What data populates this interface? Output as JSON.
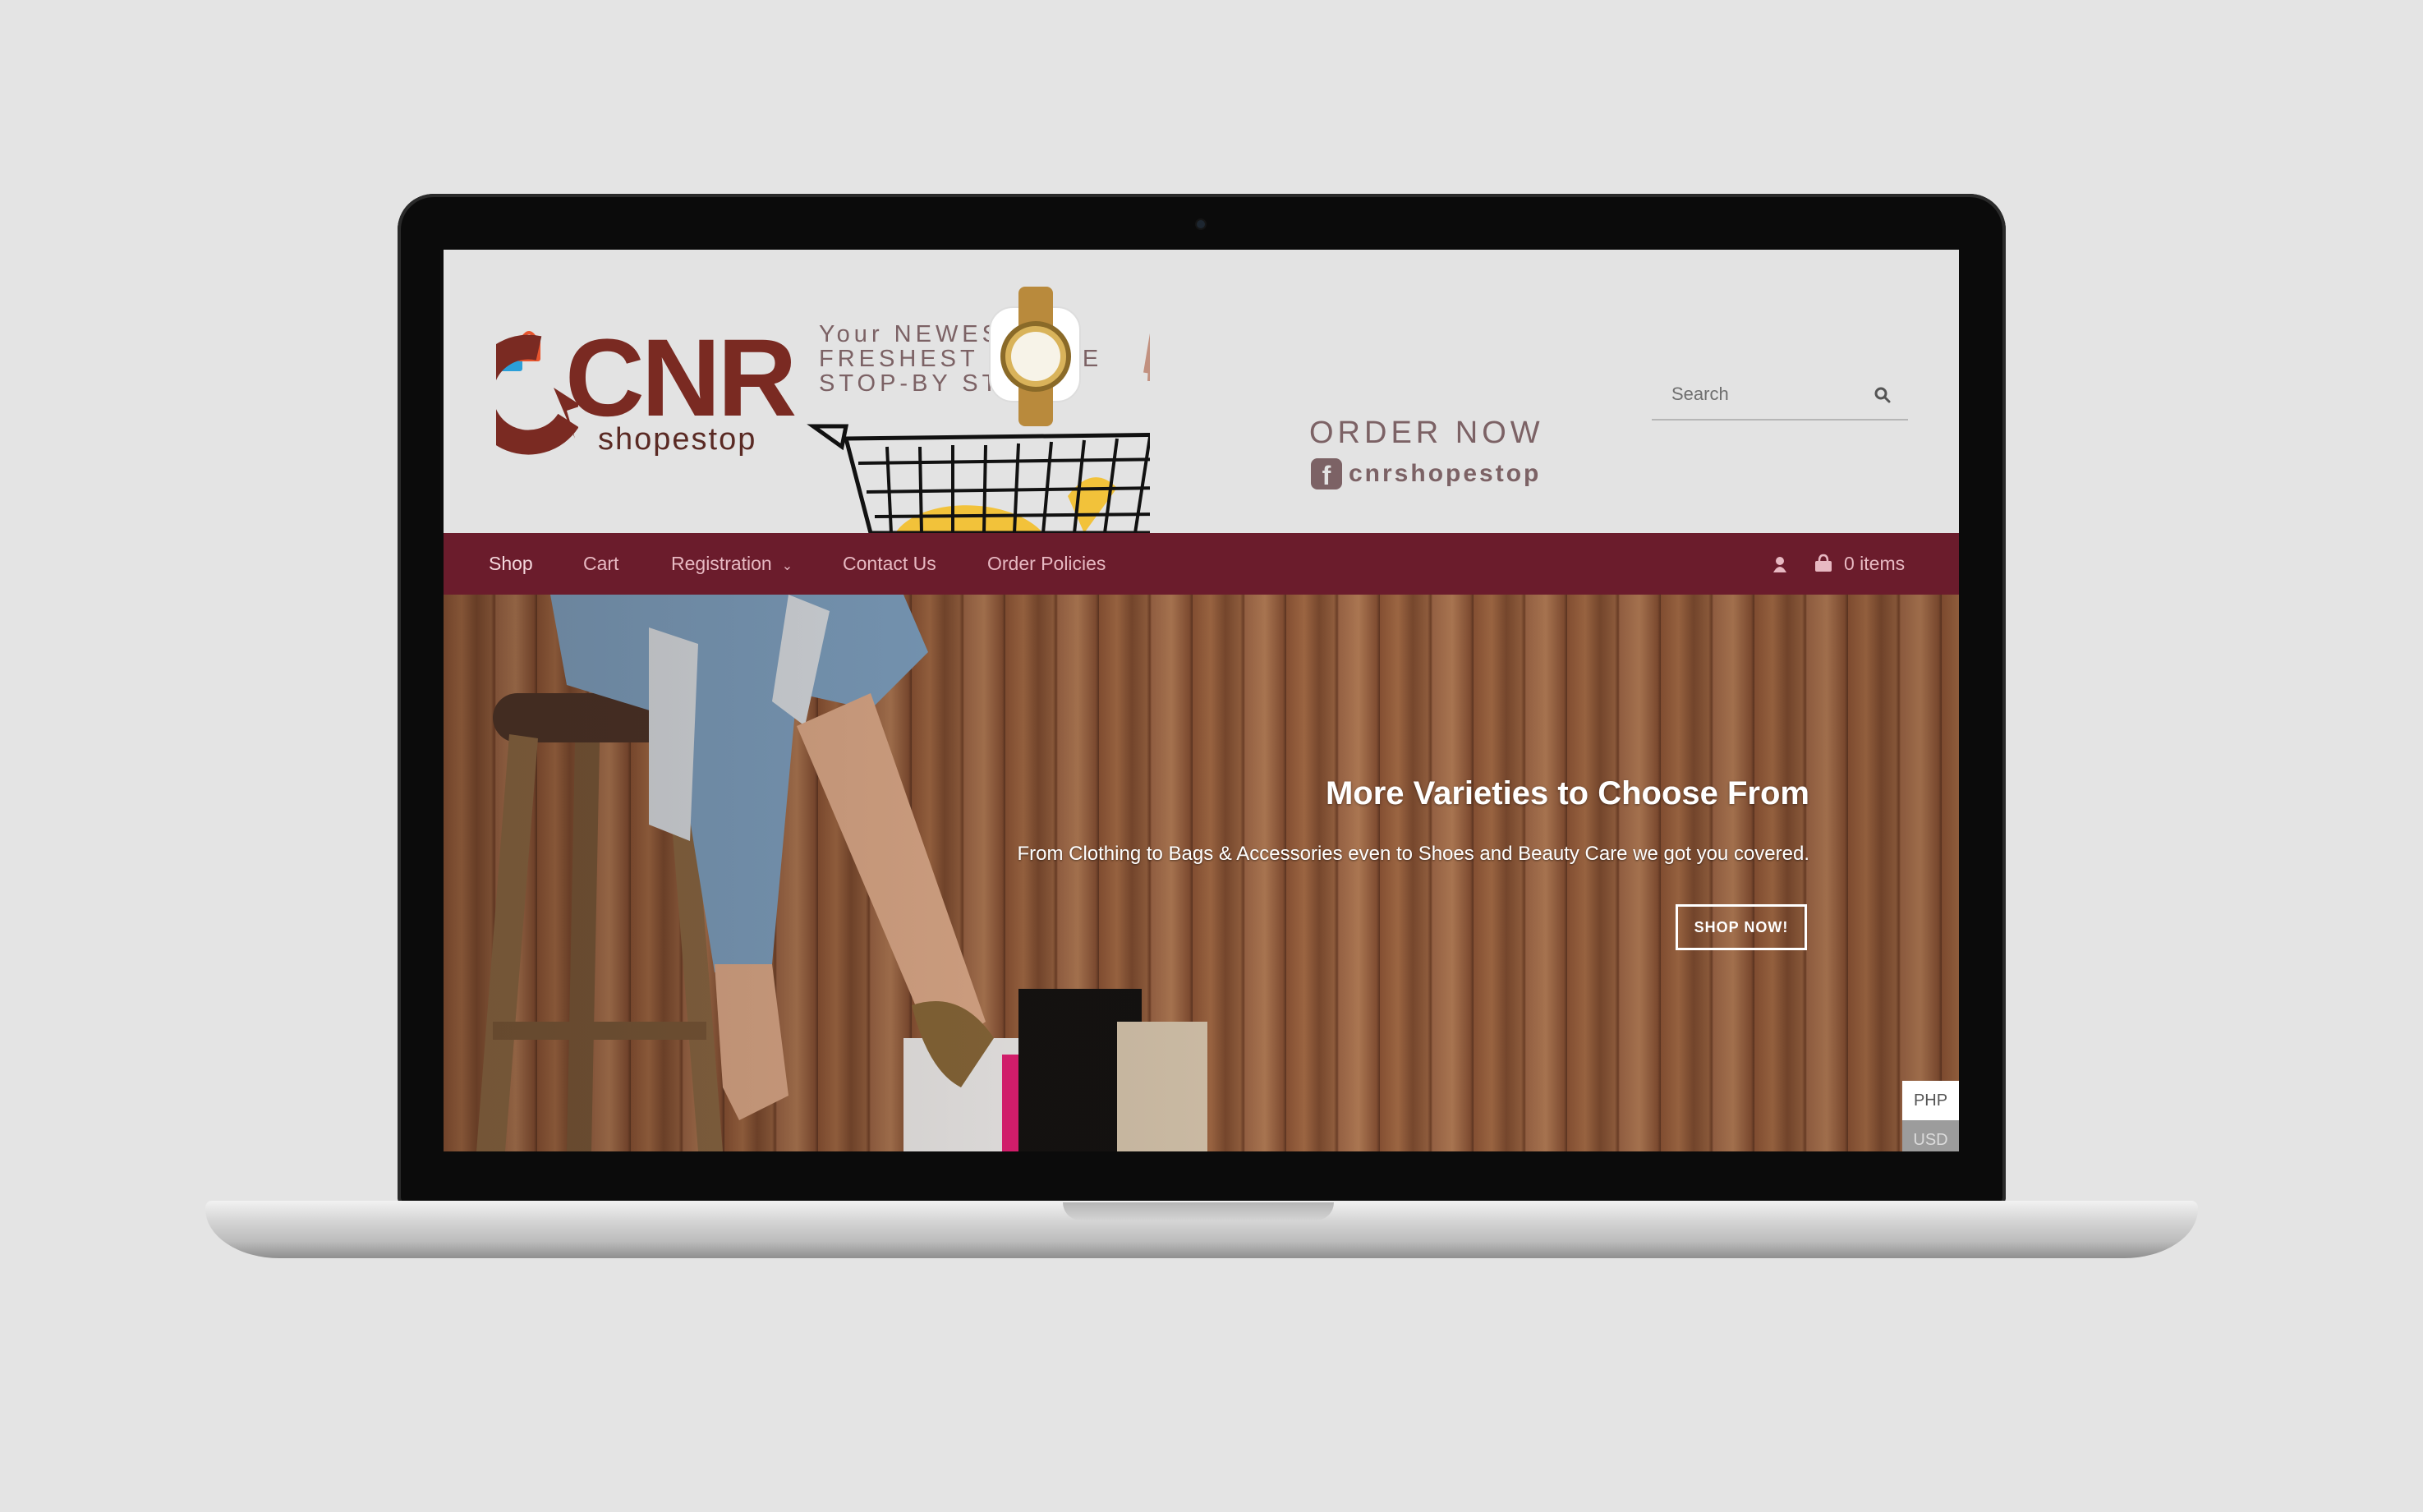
{
  "header": {
    "logo": {
      "word": "CNR",
      "sub": "shopestop"
    },
    "tagline": [
      "Your NEWEST &",
      "FRESHEST ONLINE",
      "STOP-BY STORE"
    ],
    "order_now": "ORDER NOW",
    "facebook_handle": "cnrshopestop",
    "search": {
      "placeholder": "Search"
    }
  },
  "nav": {
    "items": [
      {
        "label": "Shop"
      },
      {
        "label": "Cart"
      },
      {
        "label": "Registration"
      },
      {
        "label": "Contact Us"
      },
      {
        "label": "Order Policies"
      }
    ],
    "cart_count": "0 items"
  },
  "hero": {
    "title": "More Varieties to Choose From",
    "subtitle": "From Clothing to Bags & Accessories even to Shoes and Beauty Care we got you covered.",
    "button": "SHOP NOW!"
  },
  "currency": {
    "options": [
      "PHP",
      "USD"
    ]
  },
  "colors": {
    "nav_bg": "#6b1c2c",
    "logo_brown": "#7a2a22",
    "screen_bg": "#e3e3e3"
  }
}
